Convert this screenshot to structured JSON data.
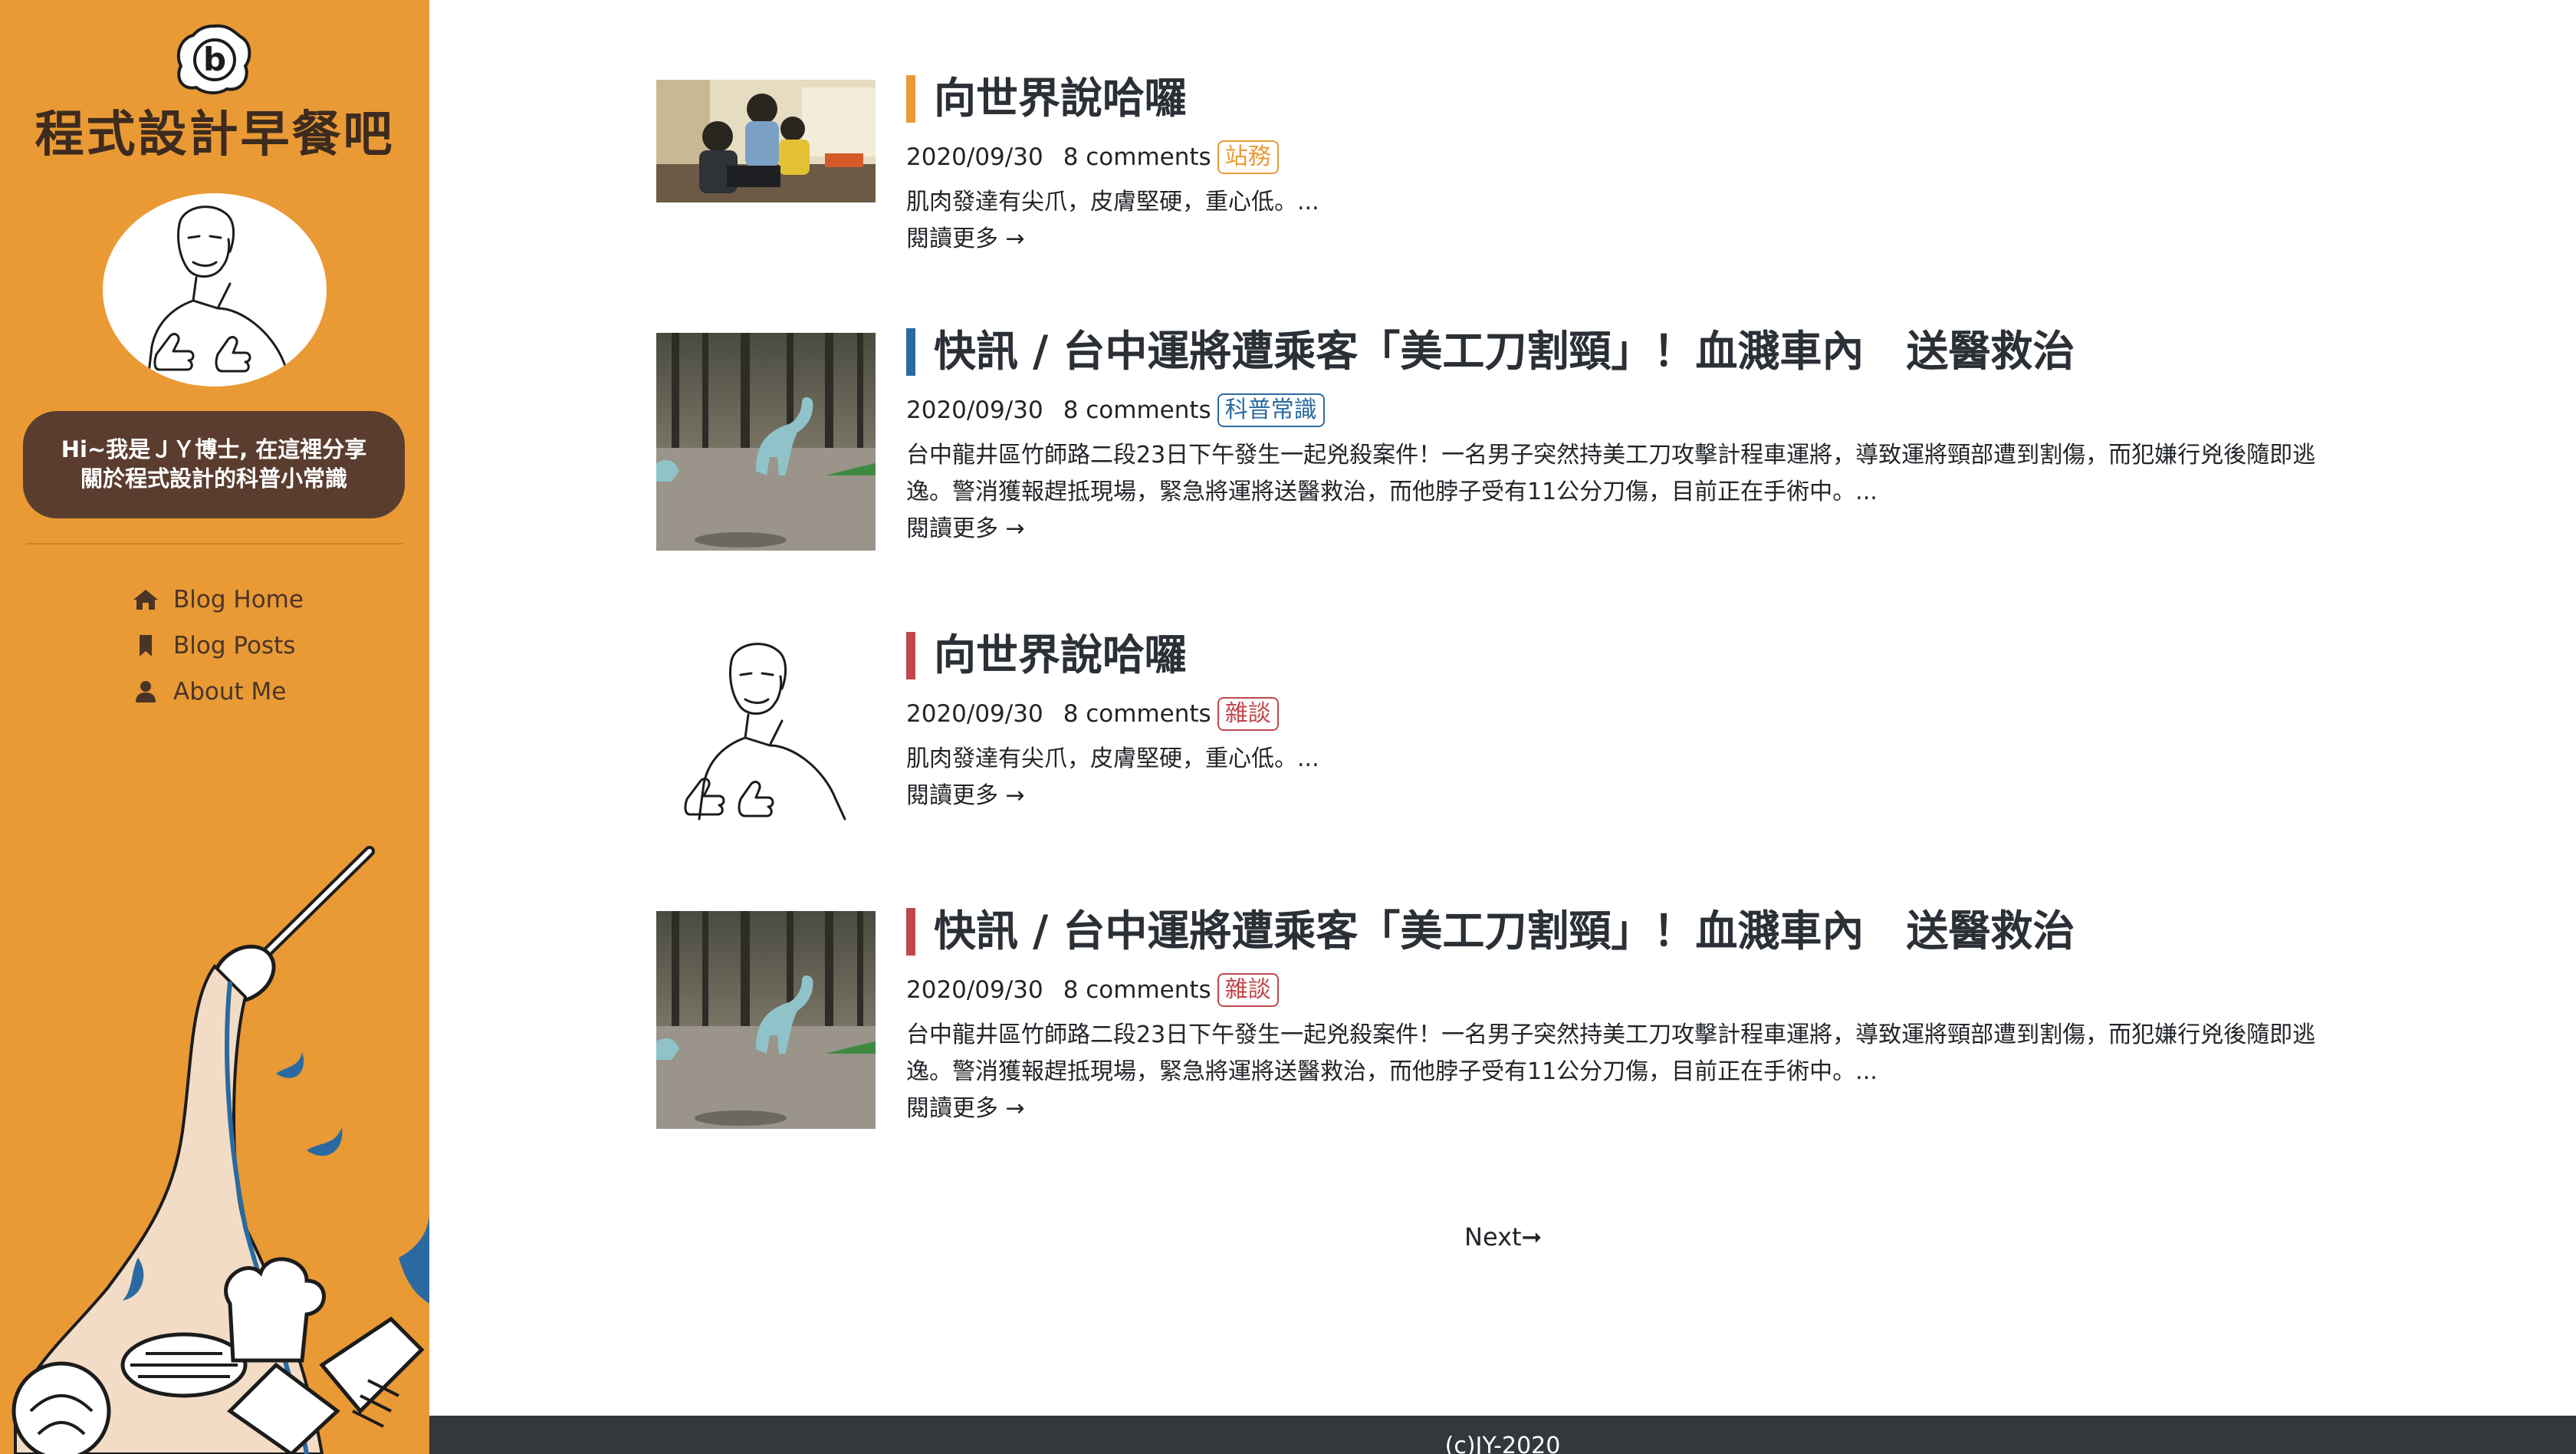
{
  "site": {
    "title": "程式設計早餐吧",
    "logo_letter": "b",
    "intro_line1": "Hi~我是ＪＹ博士, 在這裡分享",
    "intro_line2": "關於程式設計的科普小常識"
  },
  "nav": [
    {
      "label": "Blog Home",
      "icon": "home-icon"
    },
    {
      "label": "Blog Posts",
      "icon": "bookmark-icon"
    },
    {
      "label": "About Me",
      "icon": "user-icon"
    }
  ],
  "posts": [
    {
      "title": "向世界說哈囉",
      "date": "2020/09/30",
      "comments": "8 comments",
      "tag": "站務",
      "tag_color": "#e99a35",
      "bar_color": "#e99a35",
      "excerpt": "肌肉發達有尖爪，皮膚堅硬，重心低。...",
      "read_more": "閱讀更多 →",
      "thumb": "kids-at-computer-photo"
    },
    {
      "title": "快訊 / 台中運將遭乘客「美工刀割頸」！血濺車內　送醫救治",
      "date": "2020/09/30",
      "comments": "8 comments",
      "tag": "科普常識",
      "tag_color": "#2b6aa0",
      "bar_color": "#2b6aa0",
      "excerpt": "台中龍井區竹師路二段23日下午發生一起兇殺案件！一名男子突然持美工刀攻擊計程車運將，導致運將頸部遭到割傷，而犯嫌行兇後隨即逃逸。警消獲報趕抵現場，緊急將運將送醫救治，而他脖子受有11公分刀傷，目前正在手術中。...",
      "read_more": "閱讀更多 →",
      "thumb": "toy-dinosaur-forest-photo"
    },
    {
      "title": "向世界說哈囉",
      "date": "2020/09/30",
      "comments": "8 comments",
      "tag": "雜談",
      "tag_color": "#c0474b",
      "bar_color": "#c0474b",
      "excerpt": "肌肉發達有尖爪，皮膚堅硬，重心低。...",
      "read_more": "閱讀更多 →",
      "thumb": "thumbs-up-man-illustration"
    },
    {
      "title": "快訊 / 台中運將遭乘客「美工刀割頸」！血濺車內　送醫救治",
      "date": "2020/09/30",
      "comments": "8 comments",
      "tag": "雜談",
      "tag_color": "#c0474b",
      "bar_color": "#c0474b",
      "excerpt": "台中龍井區竹師路二段23日下午發生一起兇殺案件！一名男子突然持美工刀攻擊計程車運將，導致運將頸部遭到割傷，而犯嫌行兇後隨即逃逸。警消獲報趕抵現場，緊急將運將送醫救治，而他脖子受有11公分刀傷，目前正在手術中。...",
      "read_more": "閱讀更多 →",
      "thumb": "toy-dinosaur-forest-photo"
    }
  ],
  "pager": {
    "next_label": "Next➞"
  },
  "footer": {
    "text": "(c)JY-2020"
  },
  "colors": {
    "sidebar": "#e99a35",
    "bubble": "#5a3d2f",
    "footer": "#33383d"
  }
}
